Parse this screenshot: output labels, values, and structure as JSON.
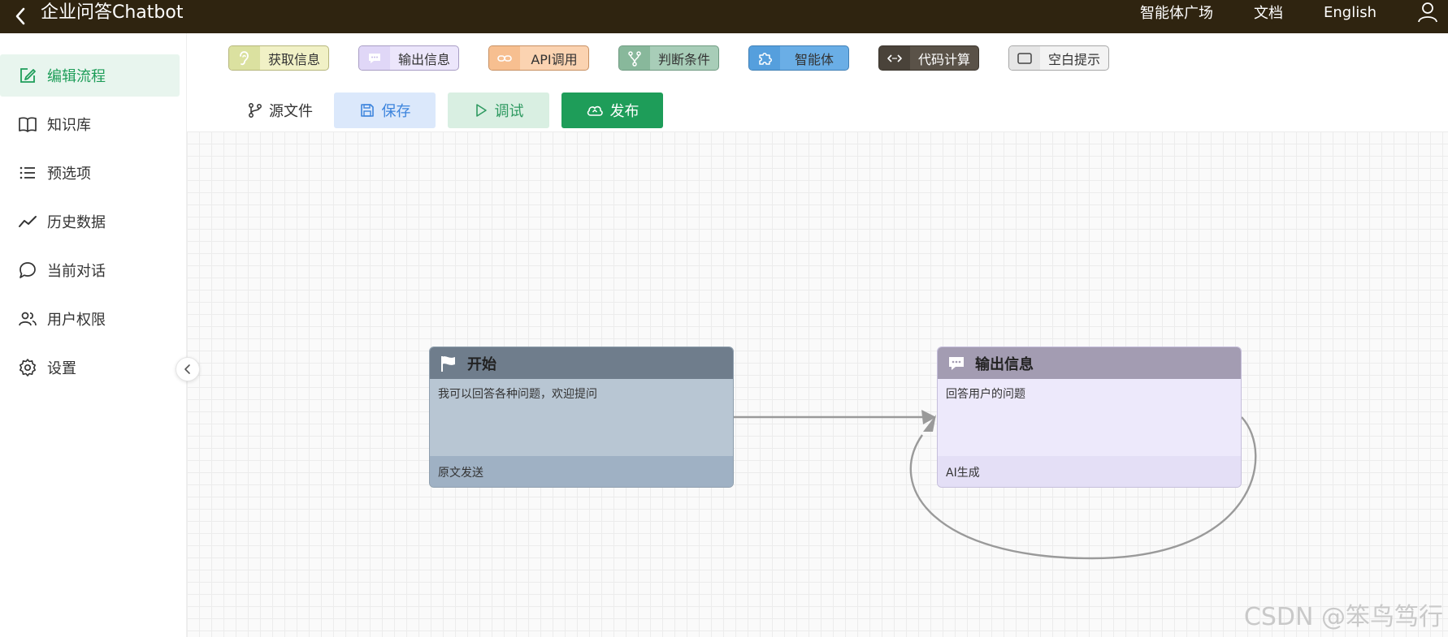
{
  "header": {
    "title": "企业问答Chatbot",
    "nav": [
      "智能体广场",
      "文档",
      "English"
    ]
  },
  "sidebar": {
    "items": [
      {
        "label": "编辑流程",
        "icon": "edit-icon",
        "active": true
      },
      {
        "label": "知识库",
        "icon": "book-icon"
      },
      {
        "label": "预选项",
        "icon": "list-icon"
      },
      {
        "label": "历史数据",
        "icon": "trend-icon"
      },
      {
        "label": "当前对话",
        "icon": "chat-icon"
      },
      {
        "label": "用户权限",
        "icon": "users-icon"
      },
      {
        "label": "设置",
        "icon": "gear-icon"
      }
    ]
  },
  "palette": [
    {
      "label": "获取信息",
      "icon": "ear-icon"
    },
    {
      "label": "输出信息",
      "icon": "message-icon"
    },
    {
      "label": "API调用",
      "icon": "link-icon"
    },
    {
      "label": "判断条件",
      "icon": "branch-icon"
    },
    {
      "label": "智能体",
      "icon": "puzzle-icon"
    },
    {
      "label": "代码计算",
      "icon": "code-icon"
    },
    {
      "label": "空白提示",
      "icon": "blank-icon"
    }
  ],
  "toolbar": {
    "source": "源文件",
    "save": "保存",
    "debug": "调试",
    "publish": "发布"
  },
  "nodes": {
    "start": {
      "title": "开始",
      "body": "我可以回答各种问题，欢迎提问",
      "footer": "原文发送"
    },
    "output": {
      "title": "输出信息",
      "body": "回答用户的问题",
      "footer": "AI生成"
    }
  },
  "watermark": "CSDN @笨鸟笃行",
  "colors": {
    "header_bg": "#2f2410",
    "accent_green": "#1e9d59",
    "start_header": "#6f7d8c",
    "start_body": "#b8c6d3",
    "output_header": "#a39cb2",
    "output_body": "#ede9fb"
  }
}
